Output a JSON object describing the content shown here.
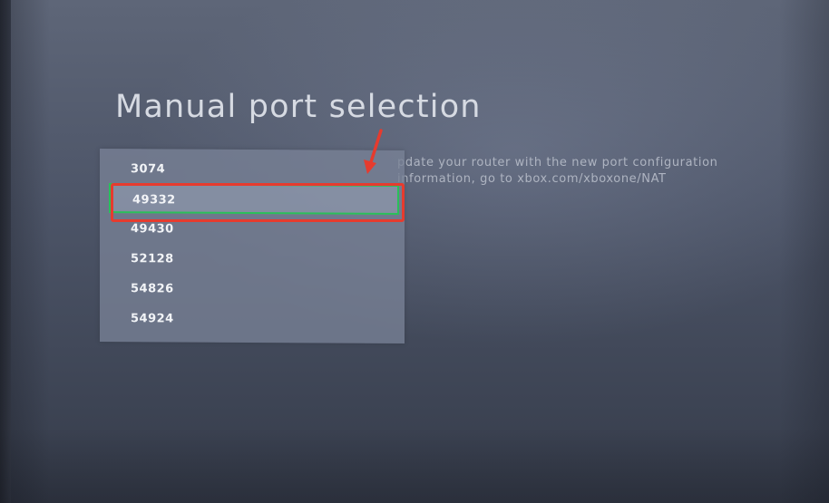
{
  "title": "Manual port selection",
  "description": {
    "line1": "pdate your router with the new port configuration",
    "line2": "information, go to xbox.com/xboxone/NAT"
  },
  "ports": [
    {
      "label": "3074",
      "selected": false
    },
    {
      "label": "49332",
      "selected": true
    },
    {
      "label": "49430",
      "selected": false
    },
    {
      "label": "52128",
      "selected": false
    },
    {
      "label": "54826",
      "selected": false
    },
    {
      "label": "54924",
      "selected": false
    }
  ],
  "colors": {
    "selection_border": "#2bbf5a",
    "annotation_red": "#e63b2e"
  },
  "annotation": {
    "arrow_icon": "red-arrow-icon",
    "highlight": "red-highlight-box"
  }
}
